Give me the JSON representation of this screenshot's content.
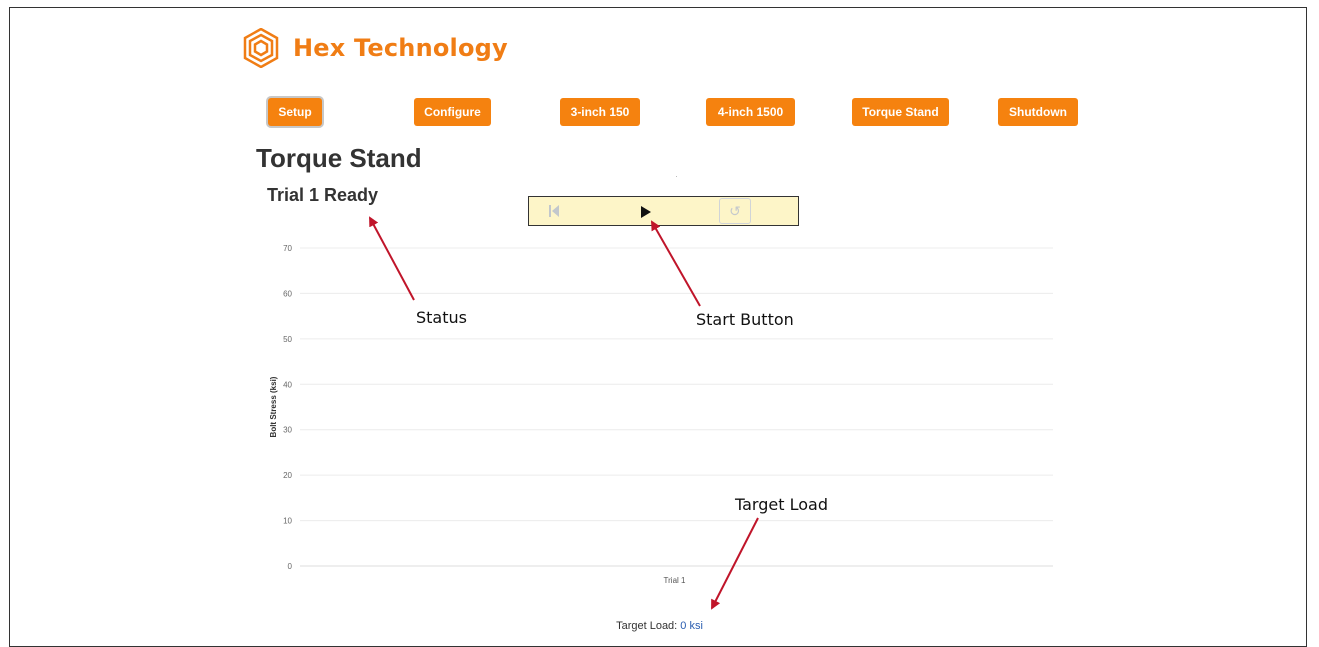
{
  "app": {
    "brand": "Hex Technology",
    "brand_color": "#f07d15"
  },
  "nav": {
    "buttons": [
      {
        "label": "Setup",
        "active": true
      },
      {
        "label": "Configure"
      },
      {
        "label": "3-inch 150"
      },
      {
        "label": "4-inch 1500"
      },
      {
        "label": "Torque Stand"
      },
      {
        "label": "Shutdown"
      }
    ]
  },
  "page": {
    "title": "Torque Stand",
    "status": "Trial 1 Ready"
  },
  "controls": {
    "icons": [
      "skip-back-icon",
      "play-icon",
      "replay-icon"
    ]
  },
  "annotations": {
    "status": "Status",
    "start_button": "Start Button",
    "target_load": "Target Load"
  },
  "chart_data": {
    "type": "bar",
    "categories": [
      "Trial 1"
    ],
    "values": [
      0
    ],
    "ylabel": "Bolt Stress (ksi)",
    "xlabel": "",
    "ylim": [
      0,
      70
    ],
    "yticks": [
      0,
      10,
      20,
      30,
      40,
      50,
      60,
      70
    ],
    "grid": true
  },
  "target": {
    "label": "Target Load:",
    "value": "0 ksi"
  }
}
